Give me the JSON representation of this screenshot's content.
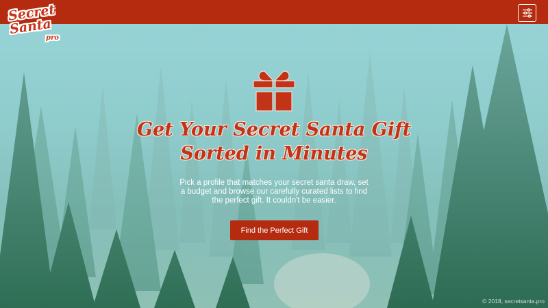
{
  "brand": {
    "logo_line1": "Secret",
    "logo_line2": "Santa",
    "logo_line3": "pro"
  },
  "header": {
    "menu_icon": "sliders-icon"
  },
  "hero": {
    "icon": "gift-icon",
    "headline_line1": "Get Your Secret Santa Gift",
    "headline_line2": "Sorted in Minutes",
    "subtitle": "Pick a profile that matches your secret santa draw, set a budget and browse our carefully curated lists to find the perfect gift. It couldn't be easier.",
    "cta_label": "Find the Perfect Gift"
  },
  "footer": {
    "copyright": "© 2018, secretsanta.pro"
  },
  "colors": {
    "brand_red": "#b52b10",
    "headline_red": "#c23417",
    "sky": "#8ccfd3",
    "tree": "#2e6f55"
  }
}
